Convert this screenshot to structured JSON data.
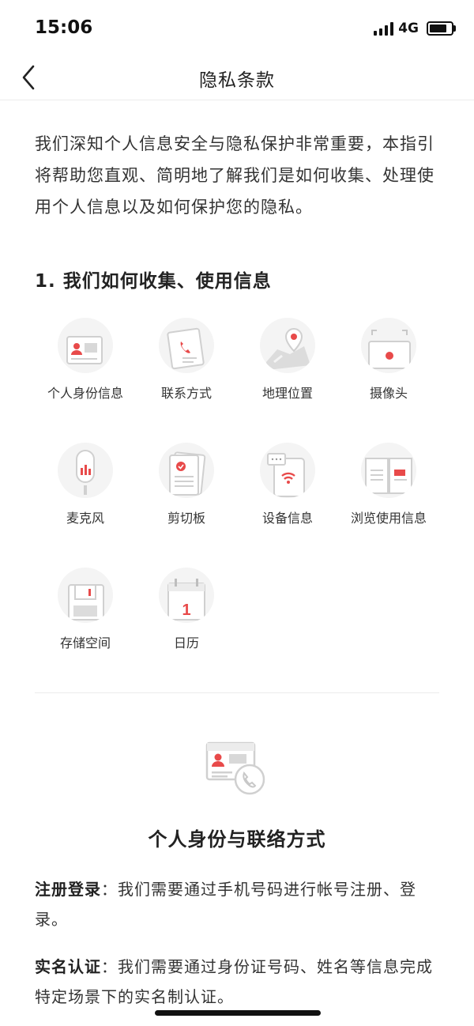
{
  "status_bar": {
    "time": "15:06",
    "network": "4G",
    "battery_level": 0.8
  },
  "nav": {
    "title": "隐私条款"
  },
  "intro": "我们深知个人信息安全与隐私保护非常重要，本指引将帮助您直观、简明地了解我们是如何收集、处理使用个人信息以及如何保护您的隐私。",
  "section": {
    "title": "1. 我们如何收集、使用信息"
  },
  "permissions": [
    {
      "label": "个人身份信息",
      "icon": "id-card-icon"
    },
    {
      "label": "联系方式",
      "icon": "phone-contact-icon"
    },
    {
      "label": "地理位置",
      "icon": "map-pin-icon"
    },
    {
      "label": "摄像头",
      "icon": "camera-icon"
    },
    {
      "label": "麦克风",
      "icon": "microphone-icon"
    },
    {
      "label": "剪切板",
      "icon": "clipboard-icon"
    },
    {
      "label": "设备信息",
      "icon": "device-wifi-icon"
    },
    {
      "label": "浏览使用信息",
      "icon": "book-icon"
    },
    {
      "label": "存储空间",
      "icon": "storage-icon"
    },
    {
      "label": "日历",
      "icon": "calendar-icon",
      "day": "1"
    }
  ],
  "detail": {
    "icon": "id-card-phone-icon",
    "title": "个人身份与联络方式",
    "paragraphs": [
      {
        "term": "注册登录",
        "separator": "：",
        "text": "我们需要通过手机号码进行帐号注册、登录。"
      },
      {
        "term": "实名认证",
        "separator": "：",
        "text": "我们需要通过身份证号码、姓名等信息完成特定场景下的实名制认证。"
      }
    ]
  },
  "colors": {
    "accent": "#e84a4a",
    "icon_gray": "#cfcfcf",
    "icon_bg": "#f4f4f4",
    "text": "#333333"
  }
}
